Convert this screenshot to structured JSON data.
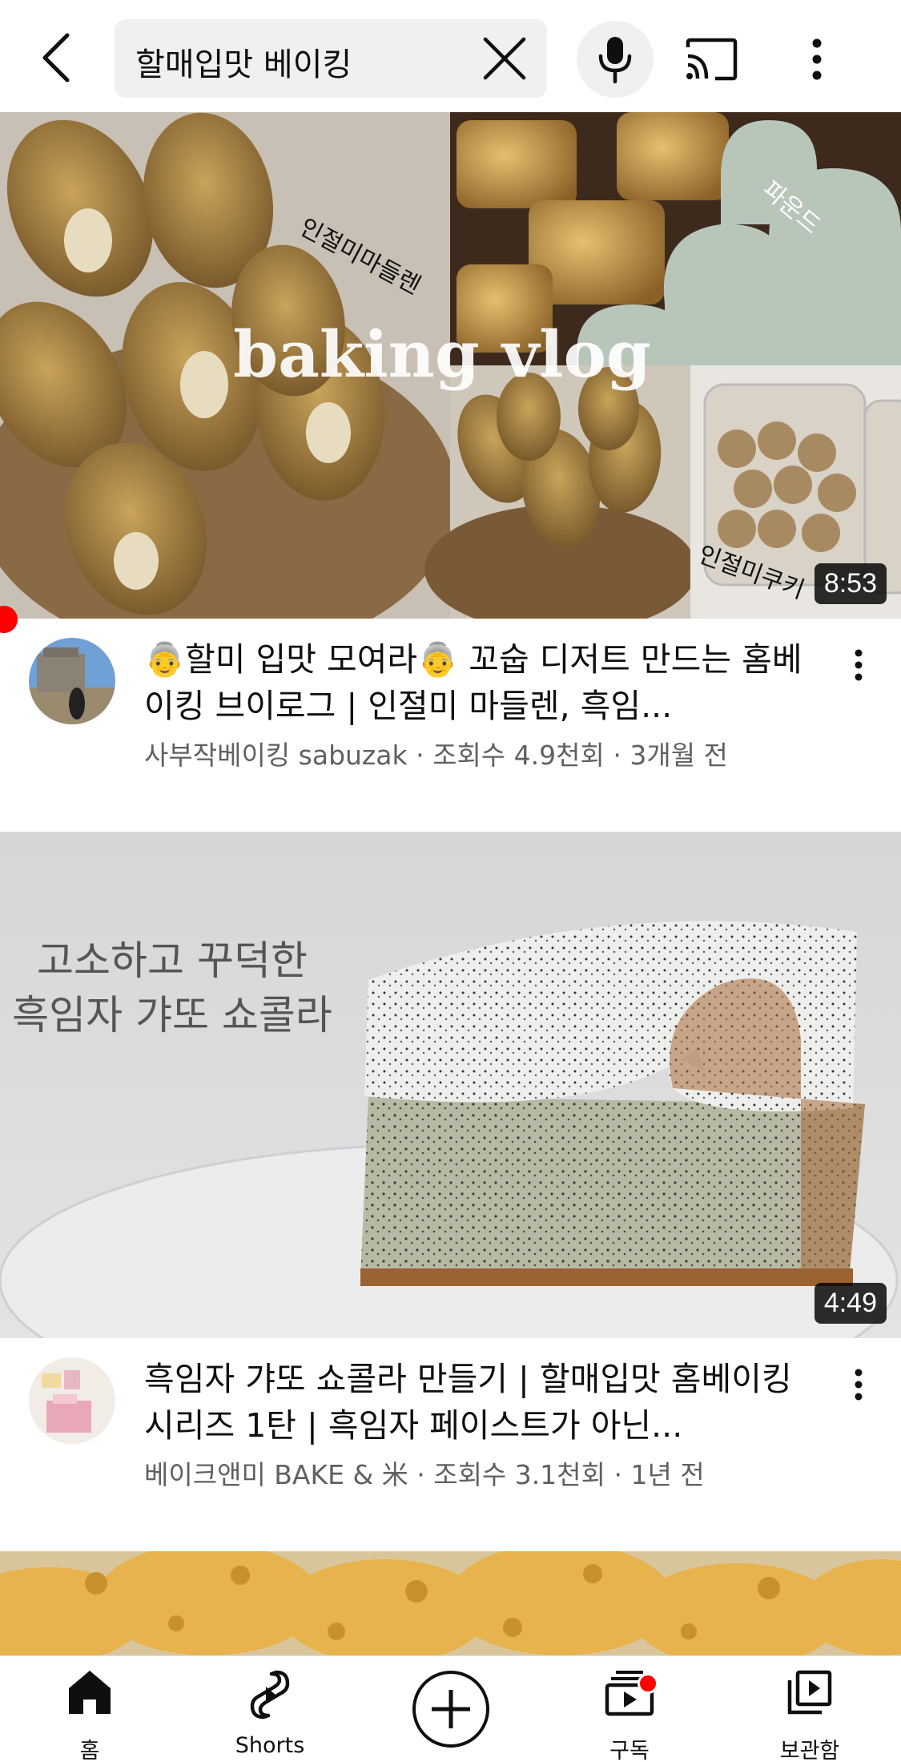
{
  "search": {
    "query": "할매입맛 베이킹"
  },
  "icons": {
    "back": "chevron-left-icon",
    "clear": "close-icon",
    "mic": "microphone-icon",
    "cast": "cast-icon",
    "more": "more-vertical-icon"
  },
  "videos": [
    {
      "thumbnail_text": [
        "baking vlog",
        "인절미마들렌",
        "파운드",
        "인절미쿠키"
      ],
      "duration": "8:53",
      "title": "👵할미 입맛 모여라👵 꼬숩 디저트 만드는 홈베이킹 브이로그 | 인절미 마들렌, 흑임...",
      "channel": "사부작베이킹 sabuzak",
      "views": "조회수 4.9천회",
      "age": "3개월 전"
    },
    {
      "thumbnail_text": [
        "고소하고 꾸덕한",
        "흑임자 갸또 쇼콜라"
      ],
      "duration": "4:49",
      "title": "흑임자 갸또 쇼콜라 만들기 | 할매입맛 홈베이킹 시리즈 1탄 | 흑임자 페이스트가 아닌...",
      "channel": "베이크앤미 BAKE & 米",
      "views": "조회수 3.1천회",
      "age": "1년 전"
    }
  ],
  "sub_separator": " · ",
  "nav": {
    "home": "홈",
    "shorts": "Shorts",
    "subscriptions": "구독",
    "library": "보관함"
  },
  "colors": {
    "accent": "#ff0000",
    "text_primary": "#0f0f0f",
    "text_secondary": "#606060",
    "search_bg": "#f0f0f0"
  }
}
